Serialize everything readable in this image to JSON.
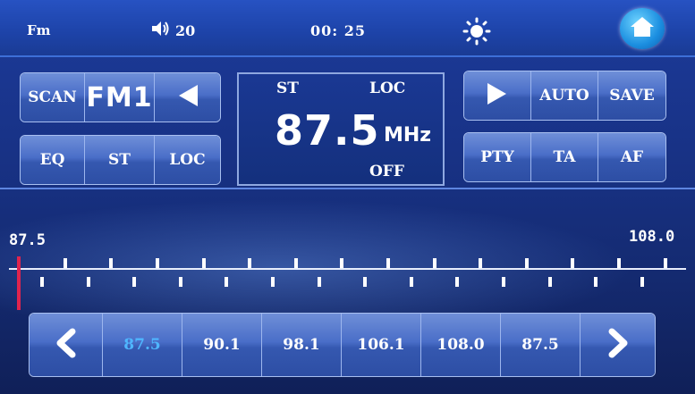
{
  "status": {
    "band": "Fm",
    "volume": "20",
    "time": "00: 25",
    "icons": [
      "speaker-icon",
      "brightness-icon",
      "home-icon"
    ]
  },
  "controls": {
    "scan": "SCAN",
    "band_label": "FM1",
    "eq": "EQ",
    "st": "ST",
    "loc": "LOC",
    "auto": "AUTO",
    "save": "SAVE",
    "pty": "PTY",
    "ta": "TA",
    "af": "AF"
  },
  "display": {
    "st_indicator": "ST",
    "loc_indicator": "LOC",
    "frequency": "87.5",
    "unit": "MHz",
    "off_label": "OFF"
  },
  "scale": {
    "min_label": "87.5",
    "max_label": "108.0",
    "current_value": 87.5,
    "range": [
      87.5,
      108.0
    ]
  },
  "presets": {
    "items": [
      "87.5",
      "90.1",
      "98.1",
      "106.1",
      "108.0",
      "87.5"
    ],
    "active_index": 0
  },
  "colors": {
    "accent": "#4fb6ff",
    "needle": "#e0244e",
    "background": "#173080"
  }
}
